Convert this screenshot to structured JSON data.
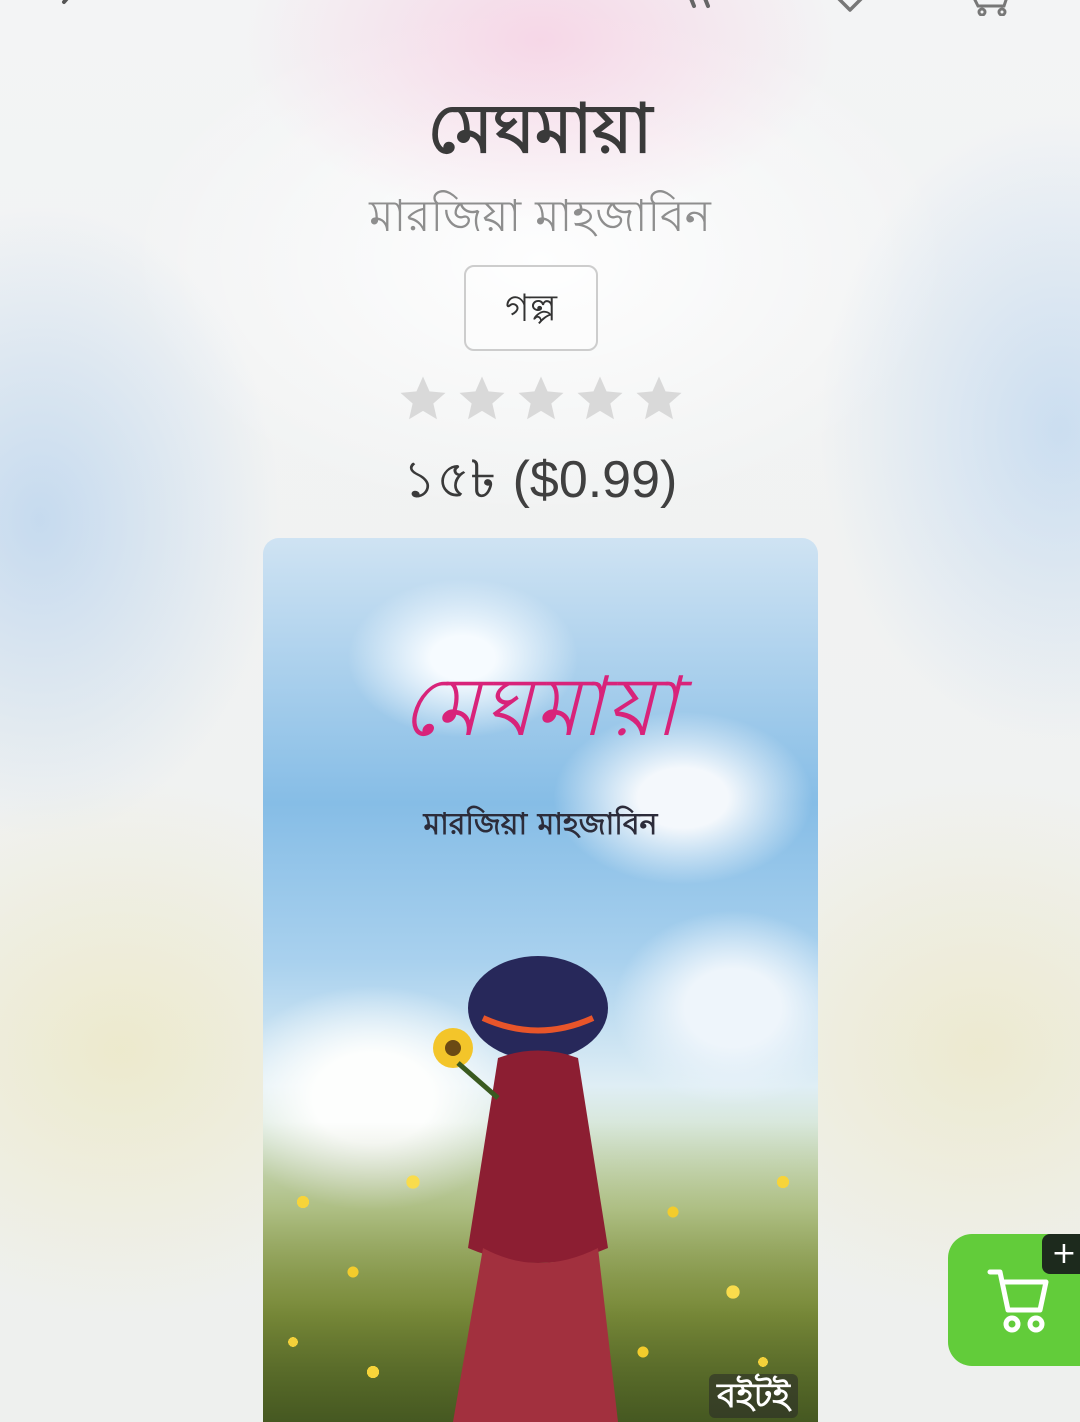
{
  "book": {
    "title": "মেঘমায়া",
    "author": "মারজিয়া মাহজাবিন",
    "category": "গল্প",
    "rating": {
      "value": 0,
      "max": 5
    },
    "price_bdt": "১৫৳",
    "price_usd": "($0.99)"
  },
  "cover": {
    "title": "মেঘমায়া",
    "author": "মারজিয়া মাহজাবিন",
    "publisher": "বইটই"
  },
  "fab": {
    "plus_label": "+"
  },
  "icons": {
    "back": "back-arrow-icon",
    "quote": "quote-icon",
    "wishlist": "heart-icon",
    "cart": "cart-icon",
    "star": "star-icon",
    "plus": "plus-icon"
  },
  "colors": {
    "accent_green": "#62cc3a",
    "star_empty": "#d9d9d9",
    "title_text": "#3a3a3a",
    "author_text": "#8e8e8e",
    "cover_title_pink": "#d8237a"
  }
}
